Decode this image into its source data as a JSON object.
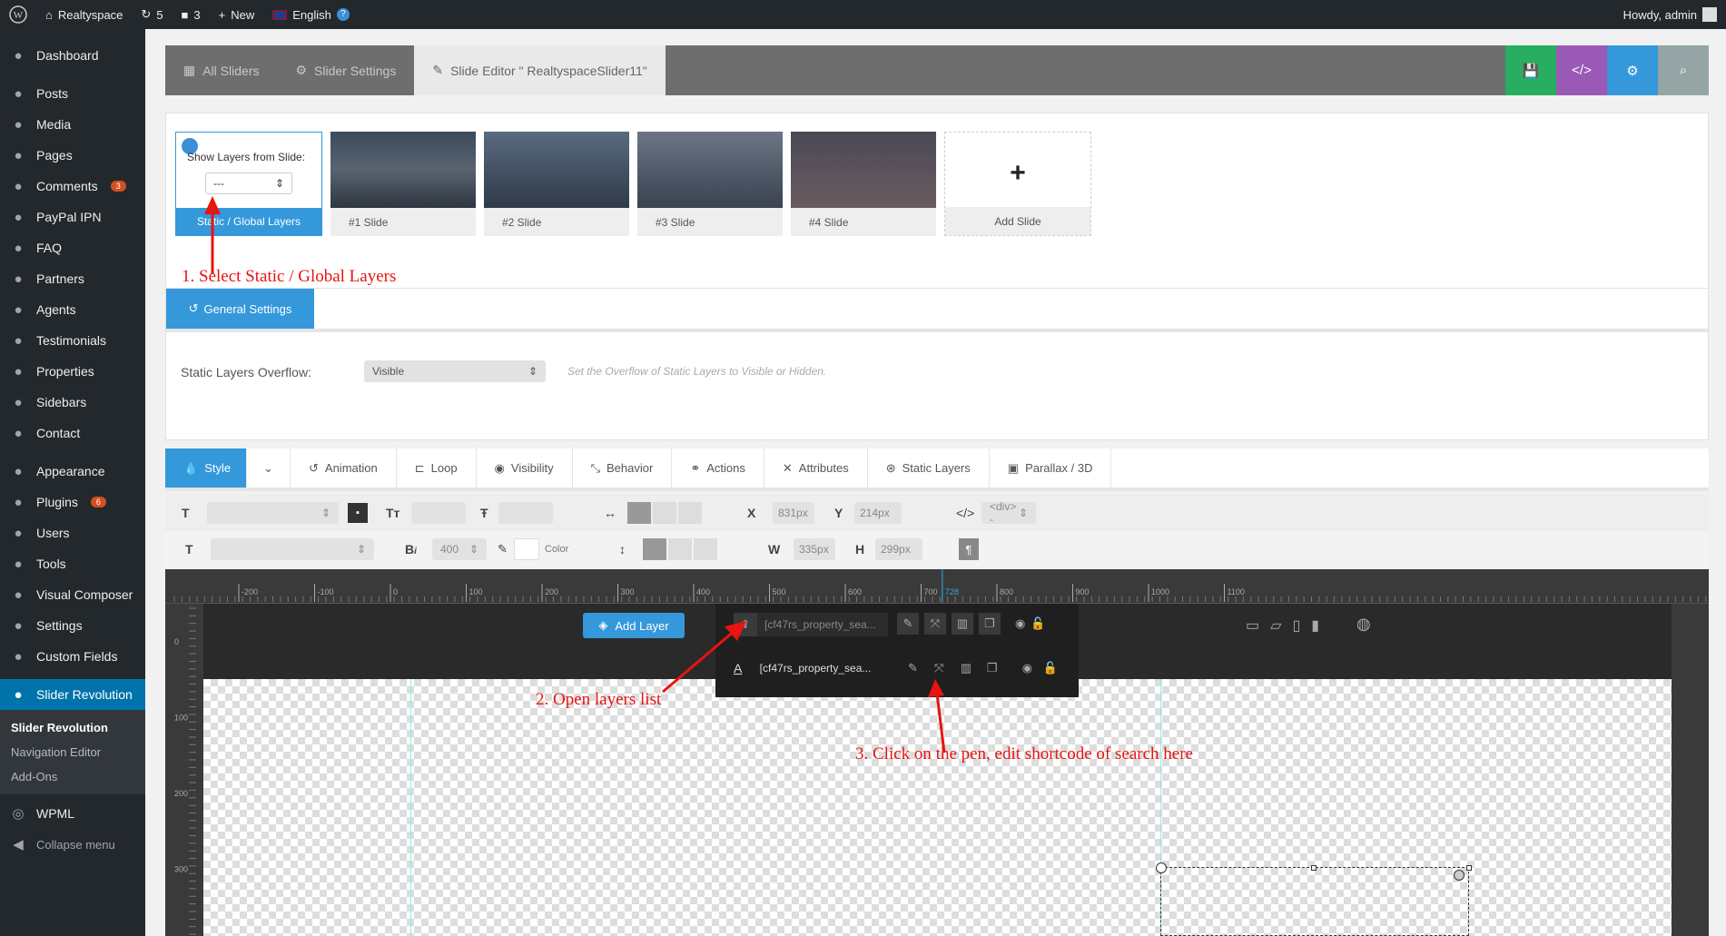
{
  "adminbar": {
    "site": "Realtyspace",
    "updates": "5",
    "comments": "3",
    "new": "New",
    "language": "English",
    "howdy": "Howdy, admin"
  },
  "sidebar": {
    "items": [
      {
        "label": "Dashboard",
        "icon": "dashboard-icon"
      },
      {
        "label": "Posts",
        "icon": "pin-icon"
      },
      {
        "label": "Media",
        "icon": "media-icon"
      },
      {
        "label": "Pages",
        "icon": "pages-icon"
      },
      {
        "label": "Comments",
        "icon": "comment-icon",
        "badge": "3"
      },
      {
        "label": "PayPal IPN",
        "icon": "paypal-icon"
      },
      {
        "label": "FAQ",
        "icon": "help-icon"
      },
      {
        "label": "Partners",
        "icon": "partners-icon"
      },
      {
        "label": "Agents",
        "icon": "user-icon"
      },
      {
        "label": "Testimonials",
        "icon": "comment-icon"
      },
      {
        "label": "Properties",
        "icon": "building-icon"
      },
      {
        "label": "Sidebars",
        "icon": "grid-icon"
      },
      {
        "label": "Contact",
        "icon": "mail-icon"
      },
      {
        "label": "Appearance",
        "icon": "brush-icon"
      },
      {
        "label": "Plugins",
        "icon": "plugin-icon",
        "badge": "6"
      },
      {
        "label": "Users",
        "icon": "users-icon"
      },
      {
        "label": "Tools",
        "icon": "wrench-icon"
      },
      {
        "label": "Visual Composer",
        "icon": "vc-icon"
      },
      {
        "label": "Settings",
        "icon": "settings-icon"
      },
      {
        "label": "Custom Fields",
        "icon": "fields-icon"
      },
      {
        "label": "Slider Revolution",
        "icon": "refresh-icon"
      }
    ],
    "submenu": [
      "Slider Revolution",
      "Navigation Editor",
      "Add-Ons"
    ],
    "wpml": "WPML",
    "collapse": "Collapse menu"
  },
  "topbar": {
    "all_sliders": "All Sliders",
    "slider_settings": "Slider Settings",
    "slide_editor": "Slide Editor \" RealtyspaceSlider11\"",
    "colors": {
      "save": "#27ae60",
      "code": "#9b59b6",
      "settings": "#3498db",
      "search": "#95a5a6"
    }
  },
  "slides": {
    "show_layers_label": "Show Layers from Slide:",
    "show_layers_value": "---",
    "static_label": "Static / Global Layers",
    "items": [
      "#1 Slide",
      "#2 Slide",
      "#3 Slide",
      "#4 Slide"
    ],
    "add_slide": "Add Slide"
  },
  "annotations": {
    "a1": "1. Select Static / Global Layers",
    "a2": "2. Open layers list",
    "a3": "3. Click on the pen, edit shortcode of search here"
  },
  "general": {
    "tab": "General Settings",
    "overflow_label": "Static Layers Overflow:",
    "overflow_value": "Visible",
    "overflow_hint": "Set the Overflow of Static Layers to Visible or Hidden."
  },
  "tabs": [
    "Style",
    "Animation",
    "Loop",
    "Visibility",
    "Behavior",
    "Actions",
    "Attributes",
    "Static Layers",
    "Parallax / 3D"
  ],
  "toolbar": {
    "x_label": "X",
    "x_value": "831px",
    "y_label": "Y",
    "y_value": "214px",
    "w_label": "W",
    "w_value": "335px",
    "h_label": "H",
    "h_value": "299px",
    "tag_value": "<div> -",
    "font_weight": "400",
    "color_label": "Color"
  },
  "ruler": {
    "ticks": [
      "-200",
      "-100",
      "0",
      "100",
      "200",
      "300",
      "400",
      "500",
      "600",
      "700",
      "800",
      "900",
      "1000",
      "1100"
    ],
    "marker": "728",
    "left_ticks": [
      "0",
      "100",
      "200",
      "300"
    ]
  },
  "layers": {
    "add_layer": "Add Layer",
    "current": "[cf47rs_property_sea...",
    "item": "[cf47rs_property_sea..."
  }
}
